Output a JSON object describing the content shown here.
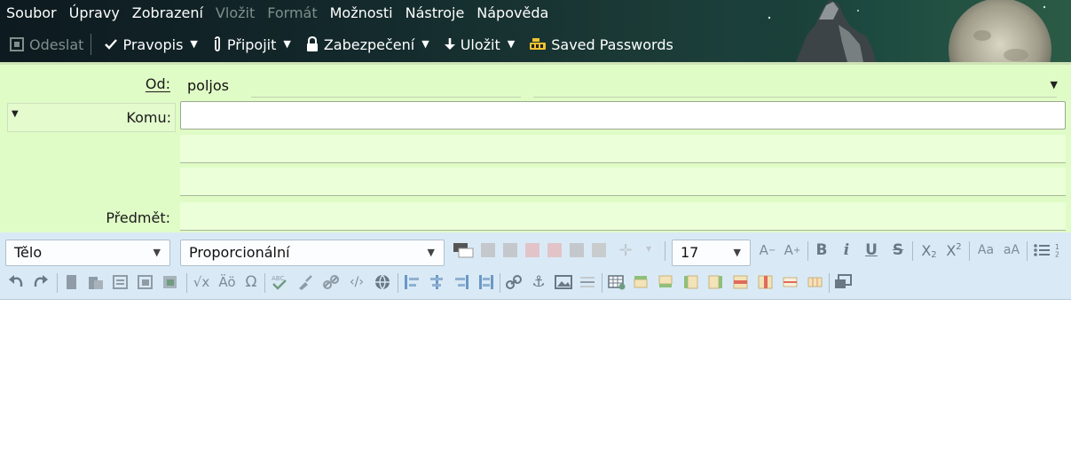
{
  "menubar": {
    "items": [
      {
        "label": "Soubor",
        "disabled": false
      },
      {
        "label": "Úpravy",
        "disabled": false
      },
      {
        "label": "Zobrazení",
        "disabled": false
      },
      {
        "label": "Vložit",
        "disabled": true
      },
      {
        "label": "Formát",
        "disabled": true
      },
      {
        "label": "Možnosti",
        "disabled": false
      },
      {
        "label": "Nástroje",
        "disabled": false
      },
      {
        "label": "Nápověda",
        "disabled": false
      }
    ]
  },
  "toolbar": {
    "send_label": "Odeslat",
    "spell_label": "Pravopis",
    "attach_label": "Připojit",
    "security_label": "Zabezpečení",
    "save_label": "Uložit",
    "passwords_label": "Saved Passwords"
  },
  "address": {
    "from_label": "Od:",
    "from_value": "poljos",
    "to_label": "Komu:",
    "to_value": "",
    "subject_label": "Předmět:",
    "subject_value": ""
  },
  "format_bar": {
    "paragraph_format": "Tělo",
    "font": "Proporcionální",
    "font_size": "17"
  },
  "colors": {
    "header_dark": "#142a2c",
    "address_bg": "#e0fcc6",
    "format_bar_bg": "#d9eaf6"
  }
}
